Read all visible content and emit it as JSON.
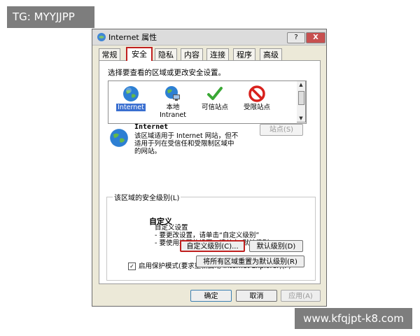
{
  "watermark_top": "TG: MYYJJPP",
  "watermark_bottom": "www.kfqjpt-k8.com",
  "dialog": {
    "title": "Internet 属性",
    "help_label": "?",
    "close_label": "X",
    "tabs": [
      "常规",
      "安全",
      "隐私",
      "内容",
      "连接",
      "程序",
      "高级"
    ],
    "active_tab": "安全"
  },
  "security": {
    "select_label": "选择要查看的区域或更改安全设置。",
    "zones": [
      {
        "label": "Internet",
        "icon": "globe-icon"
      },
      {
        "label": "本地",
        "label2": "Intranet",
        "icon": "local-intranet-icon"
      },
      {
        "label": "可信站点",
        "icon": "checkmark-icon"
      },
      {
        "label": "受限站点",
        "icon": "prohibited-icon"
      }
    ],
    "zone_name": "Internet",
    "zone_desc": "该区域适用于 Internet 网站，但不适用于列在受信任和受限制区域中的网站。",
    "sites_button": "站点(S)",
    "group_label": "该区域的安全级别(L)",
    "custom_title": "自定义",
    "custom_lines": [
      "自定义设置",
      "- 要更改设置，请单击“自定义级别”",
      "- 要使用推荐的设置，请单击“默认级别”"
    ],
    "protect_mode": "启用保护模式(要求重新启动 Internet Explorer)(P)",
    "protect_checked": "✓",
    "custom_level_button": "自定义级别(C)...",
    "default_level_button": "默认级别(D)",
    "reset_all_button": "将所有区域重置为默认级别(R)"
  },
  "footer": {
    "ok": "确定",
    "cancel": "取消",
    "apply": "应用(A)"
  }
}
